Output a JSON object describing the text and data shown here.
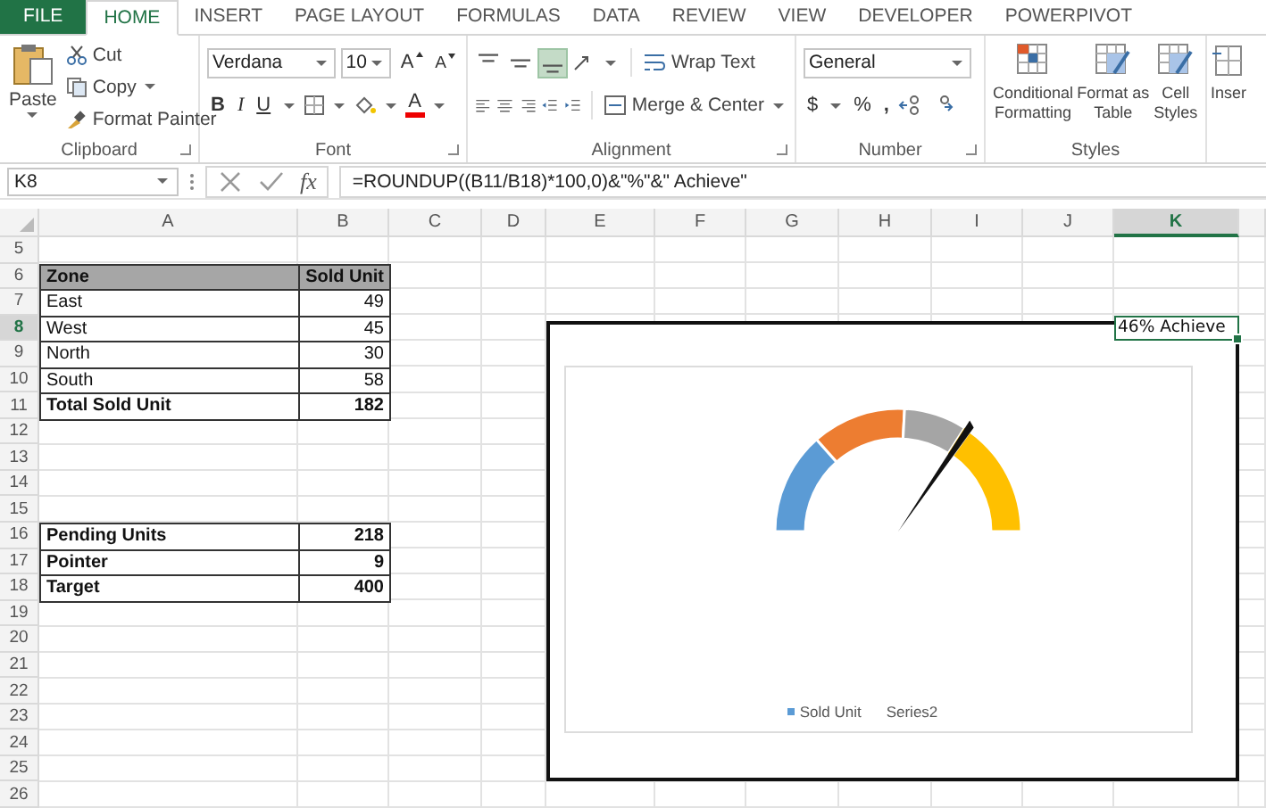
{
  "tabs": [
    {
      "label": "FILE",
      "kind": "file",
      "selected": false
    },
    {
      "label": "HOME",
      "kind": "tab",
      "selected": true
    },
    {
      "label": "INSERT",
      "kind": "tab",
      "selected": false
    },
    {
      "label": "PAGE LAYOUT",
      "kind": "tab",
      "selected": false
    },
    {
      "label": "FORMULAS",
      "kind": "tab",
      "selected": false
    },
    {
      "label": "DATA",
      "kind": "tab",
      "selected": false
    },
    {
      "label": "REVIEW",
      "kind": "tab",
      "selected": false
    },
    {
      "label": "VIEW",
      "kind": "tab",
      "selected": false
    },
    {
      "label": "DEVELOPER",
      "kind": "tab",
      "selected": false
    },
    {
      "label": "POWERPIVOT",
      "kind": "tab",
      "selected": false
    }
  ],
  "ribbon": {
    "clipboard": {
      "paste": "Paste",
      "cut": "Cut",
      "copy": "Copy",
      "format_painter": "Format Painter",
      "label": "Clipboard"
    },
    "font": {
      "name": "Verdana",
      "size": "10",
      "grow": "A",
      "shrink": "A",
      "bold": "B",
      "italic": "I",
      "underline": "U",
      "color_letter": "A",
      "label": "Font"
    },
    "alignment": {
      "vertical_align": [
        {
          "selected": false
        },
        {
          "selected": false
        },
        {
          "selected": true
        }
      ],
      "wrap_text": "Wrap Text",
      "merge_center": "Merge & Center",
      "label": "Alignment"
    },
    "number": {
      "format": "General",
      "currency": "$",
      "percent": "%",
      "comma": ",",
      "label": "Number"
    },
    "styles": {
      "buttons": [
        "Conditional Formatting",
        "Format as Table",
        "Cell Styles"
      ],
      "label": "Styles"
    },
    "cells": {
      "insert": "Inser"
    }
  },
  "formula_bar": {
    "name_box": "K8",
    "fx": "fx",
    "formula": "=ROUNDUP((B11/B18)*100,0)&\"%\"&\" Achieve\""
  },
  "sheet": {
    "columns": [
      {
        "label": "A",
        "selected": false
      },
      {
        "label": "B",
        "selected": false
      },
      {
        "label": "C",
        "selected": false
      },
      {
        "label": "D",
        "selected": false
      },
      {
        "label": "E",
        "selected": false
      },
      {
        "label": "F",
        "selected": false
      },
      {
        "label": "G",
        "selected": false
      },
      {
        "label": "H",
        "selected": false
      },
      {
        "label": "I",
        "selected": false
      },
      {
        "label": "J",
        "selected": false
      },
      {
        "label": "K",
        "selected": true
      }
    ],
    "rows": [
      {
        "label": "5",
        "selected": false
      },
      {
        "label": "6",
        "selected": false
      },
      {
        "label": "7",
        "selected": false
      },
      {
        "label": "8",
        "selected": true
      },
      {
        "label": "9",
        "selected": false
      },
      {
        "label": "10",
        "selected": false
      },
      {
        "label": "11",
        "selected": false
      },
      {
        "label": "12",
        "selected": false
      },
      {
        "label": "13",
        "selected": false
      },
      {
        "label": "14",
        "selected": false
      },
      {
        "label": "15",
        "selected": false
      },
      {
        "label": "16",
        "selected": false
      },
      {
        "label": "17",
        "selected": false
      },
      {
        "label": "18",
        "selected": false
      },
      {
        "label": "19",
        "selected": false
      },
      {
        "label": "20",
        "selected": false
      },
      {
        "label": "21",
        "selected": false
      },
      {
        "label": "22",
        "selected": false
      },
      {
        "label": "23",
        "selected": false
      },
      {
        "label": "24",
        "selected": false
      },
      {
        "label": "25",
        "selected": false
      },
      {
        "label": "26",
        "selected": false
      }
    ],
    "zone_table": {
      "headers": [
        "Zone",
        "Sold Unit"
      ],
      "rows": [
        {
          "label": "East",
          "value": "49",
          "bold": false
        },
        {
          "label": "West",
          "value": "45",
          "bold": false
        },
        {
          "label": "North",
          "value": "30",
          "bold": false
        },
        {
          "label": "South",
          "value": "58",
          "bold": false
        },
        {
          "label": "Total Sold Unit",
          "value": "182",
          "bold": true
        }
      ]
    },
    "summary_table": {
      "rows": [
        {
          "label": "Pending Units",
          "value": "218",
          "bold": true
        },
        {
          "label": "Pointer",
          "value": "9",
          "bold": true
        },
        {
          "label": "Target",
          "value": "400",
          "bold": true
        }
      ]
    },
    "active_cell": {
      "value": "46% Achieve"
    }
  },
  "chart": {
    "legend": [
      {
        "label": "Sold Unit",
        "color": "#5b9bd5"
      },
      {
        "label": "Series2"
      }
    ]
  }
}
